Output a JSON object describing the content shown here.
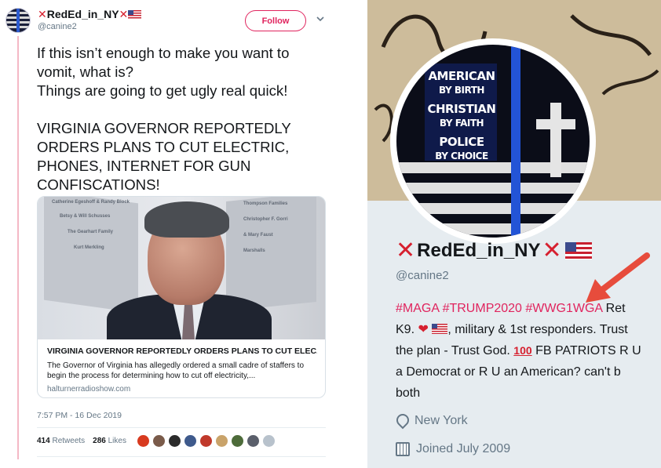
{
  "tweet": {
    "display_name": "RedEd_in_NY",
    "handle": "@canine2",
    "follow_label": "Follow",
    "text": "If this isn’t enough to make you want to vomit, what is?\nThings are going to get ugly real quick!\n\nVIRGINIA GOVERNOR REPORTEDLY ORDERS PLANS TO CUT ELECTRIC, PHONES, INTERNET FOR GUN CONFISCATIONS!",
    "card": {
      "title": "VIRGINIA GOVERNOR REPORTEDLY ORDERS PLANS TO CUT ELEC...",
      "description": "The Governor of Virginia has allegedly ordered a small cadre of staffers to begin the process for determining how to cut off electricity,...",
      "domain": "halturnerradioshow.com",
      "plaque_left": [
        "Catherine Egeshoff & Randy Block",
        "Betsy & Will Schusses",
        "The Gearhart Family",
        "Kurt Merkling"
      ],
      "plaque_right": [
        "Thompson Families",
        "Christopher F. Gorri",
        "& Mary Faust",
        "Marshalls"
      ]
    },
    "timestamp": "7:57 PM - 16 Dec 2019",
    "retweets_count": "414",
    "retweets_label": "Retweets",
    "likes_count": "286",
    "likes_label": "Likes"
  },
  "profile": {
    "display_name": "RedEd_in_NY",
    "handle": "@canine2",
    "bio": {
      "tags": "#MAGA #TRUMP2020 #WWG1WGA",
      "line1_rest": " Ret K9. ",
      "line1_after": ", military & 1st responders. Trust the plan - Trust God. ",
      "hundred": "100",
      "line2": " FB PATRIOTS R U a Democrat or R U an American? can't b both"
    },
    "location": "New York",
    "joined": "Joined July 2009",
    "avatar_text": [
      "AMERICAN",
      "BY BIRTH",
      "CHRISTIAN",
      "BY FAITH",
      "POLICE",
      "BY CHOICE"
    ]
  },
  "colors": {
    "follow_pink": "#e0245e",
    "red_x": "#d6202f",
    "arrow_red": "#e74c3c",
    "profile_bg": "#e6ecf0"
  },
  "icons": [
    "close-x-icon",
    "us-flag-icon",
    "chevron-down-icon",
    "location-pin-icon",
    "calendar-icon",
    "heart-icon",
    "hundred-points-icon",
    "red-arrow-annotation"
  ]
}
